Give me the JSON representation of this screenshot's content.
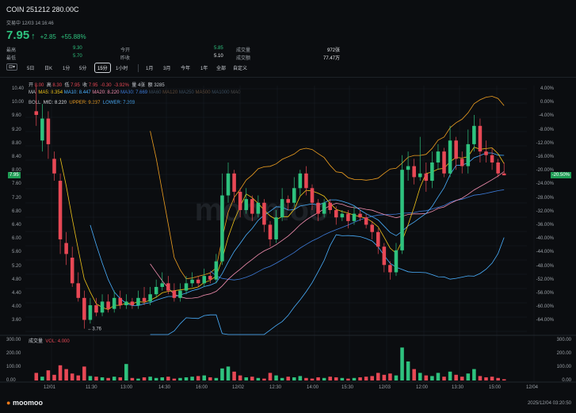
{
  "header": {
    "title": "COIN 251212 280.00C",
    "subtitle": "交易中 12/03 14:16:46",
    "price": "7.95",
    "change": "+2.85",
    "change_pct": "+55.88%",
    "stats": [
      {
        "label": "最高",
        "value": "9.30",
        "label2": "今开",
        "value2": "5.85",
        "label3": "成交量",
        "value3": "972张"
      },
      {
        "label": "最低",
        "value": "5.70",
        "label2": "昨收",
        "value2": "5.10",
        "label3": "成交额",
        "value3": "77.47万"
      }
    ]
  },
  "toolbar": {
    "settings_icon": "settings-icon",
    "tabs": [
      "5日",
      "日K",
      "1分",
      "5分",
      "15分",
      "1小时",
      "1月",
      "3月",
      "今年",
      "1年",
      "全部",
      "自定义"
    ],
    "active": "15分"
  },
  "ohlc": {
    "open_label": "开",
    "open": "8.00",
    "high_label": "高",
    "high": "8.30",
    "low_label": "低",
    "low": "7.95",
    "close_label": "收",
    "close": "7.95",
    "chg": "-0.30",
    "chg_pct": "-3.92%",
    "vol_label": "量",
    "vol": "4张",
    "amt_label": "额",
    "amt": "3285"
  },
  "ma_legend": {
    "label": "MA",
    "items": [
      {
        "text": "MA5: 8.354",
        "color": "#f0c419"
      },
      {
        "text": "MA10: 8.447",
        "color": "#4ab0ff"
      },
      {
        "text": "MA20: 8.220",
        "color": "#f48fb1"
      },
      {
        "text": "MA30: 7.669",
        "color": "#3d7bd8"
      },
      {
        "text": "MA60",
        "color": "#3a4d5e"
      },
      {
        "text": "MA120",
        "color": "#5e4a3a"
      },
      {
        "text": "MA250",
        "color": "#3a4d5e"
      },
      {
        "text": "MA500",
        "color": "#5e4a3a"
      },
      {
        "text": "MA1000",
        "color": "#3a4d5e"
      },
      {
        "text": "MA0",
        "color": "#4a4a4a"
      }
    ]
  },
  "boll_legend": {
    "label": "BOLL",
    "mid": "MID: 8.220",
    "mid_color": "#e8eaed",
    "upper": "UPPER: 9.237",
    "upper_color": "#f0a020",
    "lower": "LOWER: 7.203",
    "lower_color": "#4ab0ff"
  },
  "volume_legend": {
    "label": "成交量",
    "vol": "VOL: 4.000"
  },
  "price_axis": [
    "10.40",
    "10.00",
    "9.60",
    "9.20",
    "8.80",
    "8.40",
    "8.00",
    "7.60",
    "7.20",
    "6.80",
    "6.40",
    "6.00",
    "5.60",
    "5.20",
    "4.80",
    "4.40",
    "4.00",
    "3.60"
  ],
  "pct_axis": [
    "4.00%",
    "0.00%",
    "-4.00%",
    "-8.00%",
    "-12.00%",
    "-16.00%",
    "-20.00%",
    "-24.00%",
    "-28.00%",
    "-32.00%",
    "-36.00%",
    "-40.00%",
    "-44.00%",
    "-48.00%",
    "-52.00%",
    "-56.00%",
    "-60.00%",
    "-64.00%"
  ],
  "current_price_tag": "7.95",
  "current_pct_tag": "-20.50%",
  "vol_axis": [
    "300.00",
    "200.00",
    "100.00",
    "0.00"
  ],
  "low_marker": "3.76",
  "x_axis": [
    "12/01",
    "11:30",
    "13:00",
    "14:30",
    "16:00",
    "12/02",
    "12:30",
    "14:00",
    "15:30",
    "12/03",
    "12:00",
    "13:30",
    "15:00",
    "12/04"
  ],
  "watermark": "moomoo",
  "footer": {
    "logo": "moomoo",
    "time": "2025/12/04 03:20:50"
  },
  "colors": {
    "up": "#2ec27e",
    "down": "#e84855",
    "bg": "#0b0d10"
  },
  "chart_data": {
    "type": "candlestick",
    "title": "",
    "ylabel": "",
    "ylim": [
      3.6,
      10.4
    ],
    "bars": [
      [
        9.7,
        9.6,
        10.4,
        9.3
      ],
      [
        8.9,
        9.5,
        9.9,
        8.6
      ],
      [
        9.5,
        8.8,
        9.7,
        8.4
      ],
      [
        8.4,
        8.0,
        8.6,
        7.8
      ],
      [
        7.8,
        6.2,
        8.0,
        5.8
      ],
      [
        6.1,
        5.8,
        6.4,
        5.5
      ],
      [
        5.7,
        5.0,
        6.0,
        4.9
      ],
      [
        5.0,
        4.6,
        5.3,
        4.5
      ],
      [
        4.6,
        4.0,
        4.8,
        3.76
      ],
      [
        4.0,
        4.4,
        4.6,
        3.9
      ],
      [
        4.4,
        4.2,
        4.6,
        4.1
      ],
      [
        4.2,
        4.5,
        4.7,
        4.1
      ],
      [
        4.5,
        4.3,
        4.7,
        4.2
      ],
      [
        4.3,
        4.6,
        4.8,
        4.2
      ],
      [
        4.6,
        4.4,
        4.8,
        4.3
      ],
      [
        4.4,
        4.5,
        4.7,
        4.3
      ],
      [
        4.5,
        4.4,
        4.6,
        4.3
      ],
      [
        4.4,
        4.6,
        4.8,
        4.3
      ],
      [
        4.6,
        4.5,
        4.9,
        4.4
      ],
      [
        4.5,
        4.7,
        4.9,
        4.4
      ],
      [
        4.7,
        4.9,
        5.1,
        4.6
      ],
      [
        4.9,
        5.0,
        5.3,
        4.8
      ],
      [
        5.0,
        4.8,
        5.2,
        4.7
      ],
      [
        4.8,
        4.6,
        5.0,
        4.5
      ],
      [
        4.6,
        4.8,
        5.0,
        4.5
      ],
      [
        4.8,
        5.0,
        5.2,
        4.7
      ],
      [
        5.0,
        5.1,
        5.3,
        4.9
      ],
      [
        5.1,
        5.0,
        5.2,
        4.9
      ],
      [
        5.0,
        5.2,
        5.4,
        4.9
      ],
      [
        5.2,
        5.1,
        5.3,
        5.0
      ],
      [
        5.1,
        5.6,
        5.8,
        5.0
      ],
      [
        5.6,
        7.4,
        8.0,
        5.5
      ],
      [
        7.4,
        8.0,
        8.3,
        7.2
      ],
      [
        8.0,
        7.5,
        8.1,
        7.2
      ],
      [
        7.5,
        7.0,
        7.6,
        6.8
      ],
      [
        7.0,
        7.3,
        7.6,
        6.9
      ],
      [
        7.3,
        6.9,
        7.4,
        6.7
      ],
      [
        6.9,
        7.2,
        7.4,
        6.8
      ],
      [
        7.2,
        6.6,
        7.3,
        6.4
      ],
      [
        6.6,
        6.2,
        6.7,
        6.0
      ],
      [
        6.2,
        6.8,
        7.0,
        6.1
      ],
      [
        6.8,
        7.3,
        7.6,
        6.7
      ],
      [
        7.3,
        7.2,
        7.4,
        7.0
      ],
      [
        7.2,
        7.6,
        7.9,
        7.1
      ],
      [
        7.6,
        8.0,
        8.1,
        7.4
      ],
      [
        8.0,
        7.6,
        8.2,
        7.4
      ],
      [
        7.6,
        7.2,
        7.7,
        7.0
      ],
      [
        7.2,
        6.9,
        7.3,
        6.7
      ],
      [
        6.9,
        7.2,
        7.3,
        6.8
      ],
      [
        7.2,
        7.0,
        7.3,
        6.9
      ],
      [
        7.0,
        6.8,
        7.1,
        6.6
      ],
      [
        6.8,
        6.9,
        7.0,
        6.7
      ],
      [
        6.9,
        6.7,
        7.0,
        6.5
      ],
      [
        6.7,
        6.9,
        7.1,
        6.6
      ],
      [
        6.9,
        6.8,
        7.0,
        6.7
      ],
      [
        6.8,
        6.6,
        6.9,
        6.5
      ],
      [
        6.6,
        6.4,
        6.7,
        6.2
      ],
      [
        6.4,
        6.0,
        6.5,
        5.8
      ],
      [
        6.0,
        5.5,
        6.1,
        5.3
      ],
      [
        5.5,
        5.3,
        5.6,
        5.1
      ],
      [
        5.3,
        5.9,
        6.1,
        5.2
      ],
      [
        5.9,
        8.1,
        8.5,
        5.8
      ],
      [
        8.1,
        8.2,
        8.6,
        7.8
      ],
      [
        8.2,
        7.9,
        8.4,
        7.7
      ],
      [
        7.9,
        8.0,
        9.0,
        7.8
      ],
      [
        8.0,
        7.8,
        8.3,
        7.5
      ],
      [
        7.8,
        8.3,
        8.6,
        7.6
      ],
      [
        8.3,
        8.6,
        8.8,
        8.1
      ],
      [
        8.6,
        8.0,
        8.7,
        7.9
      ],
      [
        8.0,
        8.9,
        9.3,
        7.9
      ],
      [
        8.9,
        8.4,
        9.0,
        8.1
      ],
      [
        8.4,
        8.2,
        8.6,
        8.0
      ],
      [
        8.2,
        8.8,
        9.2,
        8.0
      ],
      [
        8.8,
        9.3,
        9.6,
        8.6
      ],
      [
        9.3,
        8.6,
        9.5,
        8.3
      ],
      [
        8.6,
        8.5,
        8.9,
        8.3
      ],
      [
        8.5,
        8.3,
        8.7,
        8.1
      ],
      [
        8.3,
        8.0,
        8.4,
        7.9
      ],
      [
        8.0,
        7.95,
        8.3,
        7.95
      ]
    ],
    "volume": [
      60,
      30,
      80,
      45,
      120,
      90,
      55,
      40,
      110,
      35,
      30,
      25,
      20,
      30,
      25,
      130,
      20,
      15,
      25,
      30,
      20,
      25,
      30,
      15,
      20,
      25,
      30,
      35,
      40,
      25,
      20,
      95,
      110,
      70,
      40,
      25,
      30,
      20,
      15,
      60,
      40,
      20,
      30,
      25,
      35,
      20,
      15,
      25,
      20,
      30,
      25,
      20,
      15,
      20,
      25,
      30,
      35,
      60,
      45,
      55,
      40,
      260,
      150,
      90,
      60,
      40,
      35,
      60,
      30,
      70,
      45,
      30,
      55,
      90,
      35,
      25,
      30,
      20,
      10
    ]
  }
}
